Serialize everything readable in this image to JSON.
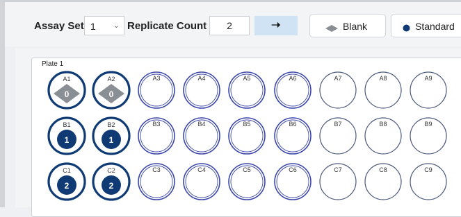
{
  "toolbar": {
    "assay_set_label": "Assay Set",
    "assay_set_value": "1",
    "replicate_count_label": "Replicate Count",
    "replicate_count_value": "2",
    "go_icon": "right-arrow-icon",
    "blank_label": "Blank",
    "blank_icon": "diamond-icon",
    "standard_label": "Standard",
    "standard_icon": "circle-icon"
  },
  "plate": {
    "title": "Plate 1",
    "rows": [
      {
        "row": "A",
        "wells": [
          {
            "label": "A1",
            "type": "blank",
            "value": "0"
          },
          {
            "label": "A2",
            "type": "blank",
            "value": "0"
          },
          {
            "label": "A3",
            "type": "empty",
            "value": ""
          },
          {
            "label": "A4",
            "type": "empty",
            "value": ""
          },
          {
            "label": "A5",
            "type": "empty",
            "value": ""
          },
          {
            "label": "A6",
            "type": "empty",
            "value": ""
          },
          {
            "label": "A7",
            "type": "empty",
            "value": ""
          },
          {
            "label": "A8",
            "type": "empty",
            "value": ""
          },
          {
            "label": "A9",
            "type": "empty",
            "value": ""
          }
        ]
      },
      {
        "row": "B",
        "wells": [
          {
            "label": "B1",
            "type": "standard",
            "value": "1"
          },
          {
            "label": "B2",
            "type": "standard",
            "value": "1"
          },
          {
            "label": "B3",
            "type": "empty",
            "value": ""
          },
          {
            "label": "B4",
            "type": "empty",
            "value": ""
          },
          {
            "label": "B5",
            "type": "empty",
            "value": ""
          },
          {
            "label": "B6",
            "type": "empty",
            "value": ""
          },
          {
            "label": "B7",
            "type": "empty",
            "value": ""
          },
          {
            "label": "B8",
            "type": "empty",
            "value": ""
          },
          {
            "label": "B9",
            "type": "empty",
            "value": ""
          }
        ]
      },
      {
        "row": "C",
        "wells": [
          {
            "label": "C1",
            "type": "standard",
            "value": "2"
          },
          {
            "label": "C2",
            "type": "standard",
            "value": "2"
          },
          {
            "label": "C3",
            "type": "empty",
            "value": ""
          },
          {
            "label": "C4",
            "type": "empty",
            "value": ""
          },
          {
            "label": "C5",
            "type": "empty",
            "value": ""
          },
          {
            "label": "C6",
            "type": "empty",
            "value": ""
          },
          {
            "label": "C7",
            "type": "empty",
            "value": ""
          },
          {
            "label": "C8",
            "type": "empty",
            "value": ""
          },
          {
            "label": "C9",
            "type": "empty",
            "value": ""
          }
        ]
      }
    ]
  },
  "colors": {
    "well_dark": "#0f3a74",
    "well_blue": "#2f49b8",
    "well_outline": "#3a47a8",
    "well_outline_light": "#4b577c",
    "blank_diamond": "#8a8f96",
    "go_button_bg": "#cfe3f4"
  }
}
